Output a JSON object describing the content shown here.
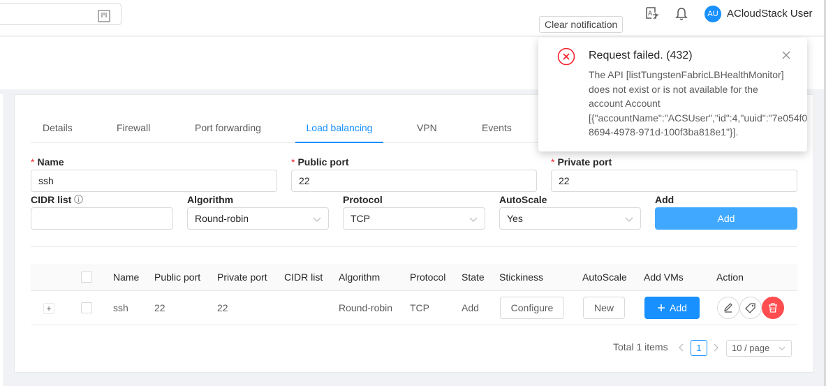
{
  "header": {
    "search_placeholder": "",
    "tooltip": "Clear notification",
    "user": {
      "initials": "AU",
      "name": "ACloudStack User"
    },
    "icons": [
      "search-icon",
      "translate-icon",
      "bell-icon"
    ]
  },
  "tabs": [
    {
      "label": "Details",
      "active": false
    },
    {
      "label": "Firewall",
      "active": false
    },
    {
      "label": "Port forwarding",
      "active": false
    },
    {
      "label": "Load balancing",
      "active": true
    },
    {
      "label": "VPN",
      "active": false
    },
    {
      "label": "Events",
      "active": false
    }
  ],
  "form": {
    "name": {
      "label": "Name",
      "value": "ssh"
    },
    "public_port": {
      "label": "Public port",
      "value": "22"
    },
    "private_port": {
      "label": "Private port",
      "value": "22"
    },
    "cidr": {
      "label": "CIDR list",
      "value": ""
    },
    "algorithm": {
      "label": "Algorithm",
      "value": "Round-robin"
    },
    "protocol": {
      "label": "Protocol",
      "value": "TCP"
    },
    "autoscale": {
      "label": "AutoScale",
      "value": "Yes"
    },
    "add": {
      "label": "Add",
      "button": "Add"
    }
  },
  "table": {
    "columns": [
      "Name",
      "Public port",
      "Private port",
      "CIDR list",
      "Algorithm",
      "Protocol",
      "State",
      "Stickiness",
      "AutoScale",
      "Add VMs",
      "Action"
    ],
    "rows": [
      {
        "expander": "+",
        "name": "ssh",
        "public_port": "22",
        "private_port": "22",
        "cidr": "",
        "algorithm": "Round-robin",
        "protocol": "TCP",
        "state": "Add",
        "stickiness_button": "Configure",
        "autoscale_button": "New",
        "add_vms_button": "Add"
      }
    ]
  },
  "pagination": {
    "total": "Total 1 items",
    "current": "1",
    "page_size": "10 / page"
  },
  "notification": {
    "title": "Request failed. (432)",
    "lines": [
      "The API [listTungstenFabricLBHealthMonitor]",
      "does not exist or is not available for the",
      "account Account",
      "[{\"accountName\":\"ACSUser\",\"id\":4,\"uuid\":\"7e054f0",
      "8694-4978-971d-100f3ba818e1\"}]."
    ]
  },
  "colors": {
    "primary": "#1890ff",
    "primary_light": "#40a9ff",
    "danger": "#ff4d4f",
    "error_icon": "#f5222d"
  }
}
